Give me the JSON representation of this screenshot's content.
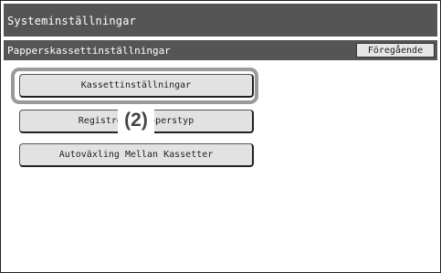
{
  "header": {
    "title": "Systeminställningar"
  },
  "subheader": {
    "title": "Papperskassettinställningar",
    "back_button": "Föregående"
  },
  "menu": {
    "items": [
      {
        "label": "Kassettinställningar"
      },
      {
        "label": "Registrera Papperstyp"
      },
      {
        "label": "Autoväxling Mellan Kassetter"
      }
    ]
  },
  "annotation": {
    "label": "(2)"
  },
  "colors": {
    "bar_background": "#555555",
    "button_background": "#e2e2e2",
    "highlight_border": "#9a9a9a"
  }
}
